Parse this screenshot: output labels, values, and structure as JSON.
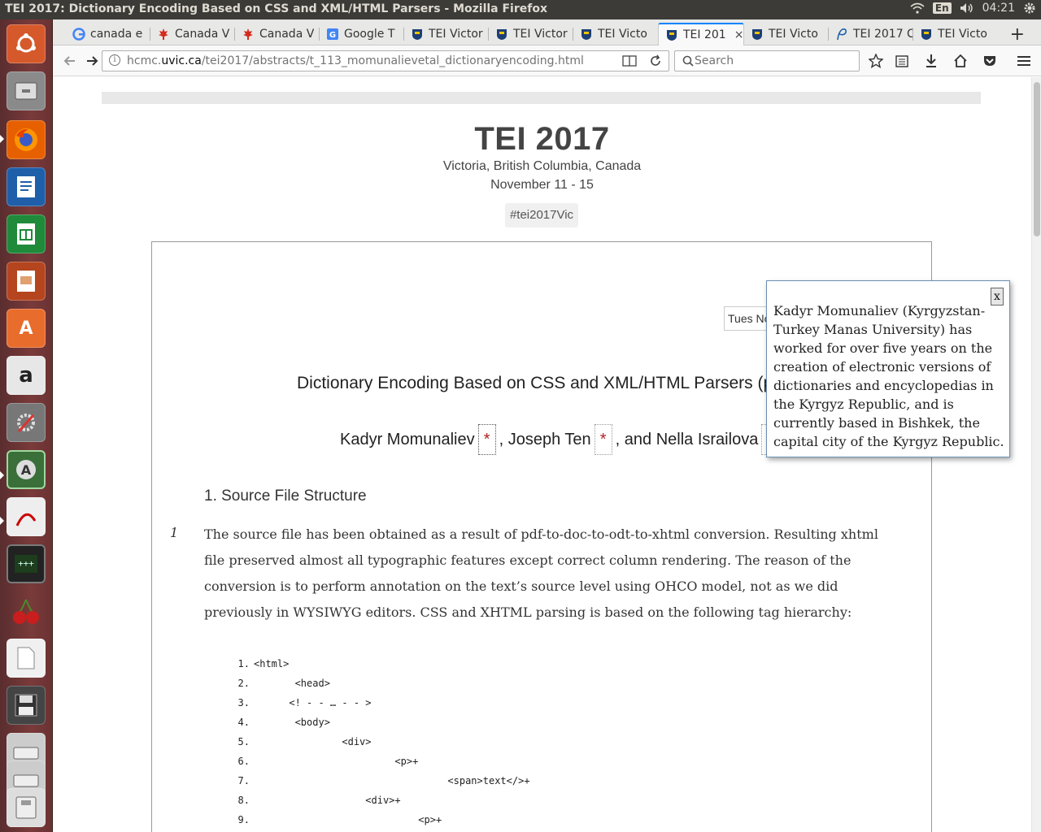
{
  "system": {
    "window_title": "TEI 2017: Dictionary Encoding Based on CSS and XML/HTML Parsers - Mozilla Firefox",
    "lang": "En",
    "clock": "04:21"
  },
  "launcher": {
    "items": [
      "ubuntu-dash",
      "files",
      "firefox",
      "libreoffice-writer",
      "libreoffice-calc",
      "libreoffice-impress",
      "ubuntu-software",
      "amazon",
      "system-settings",
      "software-updater",
      "pdf-viewer",
      "system-monitor",
      "cherrytree",
      "text-file",
      "save-floppy",
      "drive",
      "removable-drive"
    ]
  },
  "tabs": [
    {
      "label": "canada e",
      "icon": "google-icon"
    },
    {
      "label": "Canada V",
      "icon": "maple-leaf-icon"
    },
    {
      "label": "Canada V",
      "icon": "maple-leaf-icon"
    },
    {
      "label": "Google T",
      "icon": "google-translate-icon"
    },
    {
      "label": "TEI Victor",
      "icon": "uvic-shield-icon"
    },
    {
      "label": "TEI Victor",
      "icon": "uvic-shield-icon"
    },
    {
      "label": "TEI Victo",
      "icon": "uvic-shield-icon"
    },
    {
      "label": "TEI 201",
      "icon": "uvic-shield-icon",
      "active": true
    },
    {
      "label": "TEI Victo",
      "icon": "uvic-shield-icon"
    },
    {
      "label": "TEI 2017 C",
      "icon": "p-icon"
    },
    {
      "label": "TEI Victo",
      "icon": "uvic-shield-icon"
    }
  ],
  "tab_close": "×",
  "new_tab": "+",
  "nav": {
    "url_prefix": "hcmc.",
    "url_domain": "uvic.ca",
    "url_path": "/tei2017/abstracts/t_113_momunalievetal_dictionaryencoding.html",
    "search_placeholder": "Search"
  },
  "page": {
    "conf_title": "TEI 2017",
    "location": "Victoria, British Columbia, Canada",
    "dates": "November 11 - 15",
    "hashtag": "#tei2017Vic",
    "date_box": "Tues Nov",
    "paper_title": "Dictionary Encoding Based on CSS and XML/HTML Parsers (post",
    "authors": [
      {
        "name": "Kadyr Momunaliev",
        "marker": "*"
      },
      {
        "name": ", Joseph Ten",
        "marker": "*"
      },
      {
        "name": ", and Nella Israilova",
        "marker": "*"
      }
    ],
    "section_heading": "1. Source File Structure",
    "para_number": "1",
    "paragraph": "The source file has been obtained as a result of pdf-to-doc-to-odt-to-xhtml conversion. Resulting xhtml file preserved almost all typographic features except correct column rendering. The reason of the conversion is to perform annotation on the text’s source level using OHCO model, not as we did previously in WYSIWYG editors. CSS and XHTML parsing is based on the following tag hierarchy:",
    "code_lines": [
      {
        "n": "1.",
        "text": "<html>"
      },
      {
        "n": "2.",
        "text": "       <head>"
      },
      {
        "n": "3.",
        "text": "      <! - - … - - >"
      },
      {
        "n": "4.",
        "text": "       <body>"
      },
      {
        "n": "5.",
        "text": "               <div>"
      },
      {
        "n": "6.",
        "text": "                        <p>+"
      },
      {
        "n": "7.",
        "text": "                                 <span>text</>+"
      },
      {
        "n": "8.",
        "text": "                   <div>+"
      },
      {
        "n": "9.",
        "text": "                            <p>+"
      }
    ]
  },
  "popup": {
    "close": "x",
    "text": "Kadyr Momunaliev (Kyrgyzstan-Turkey Manas University) has worked for over five years on the creation of electronic versions of dictionaries and encyclopedias in the Kyrgyz Republic, and is currently based in Bishkek, the capital city of the Kyrgyz Republic."
  },
  "colors": {
    "launcher_bg": "#6a3233",
    "panel_bg": "#3c3b37",
    "accent_tab": "#0a84ff",
    "marker_red": "#b22222"
  }
}
